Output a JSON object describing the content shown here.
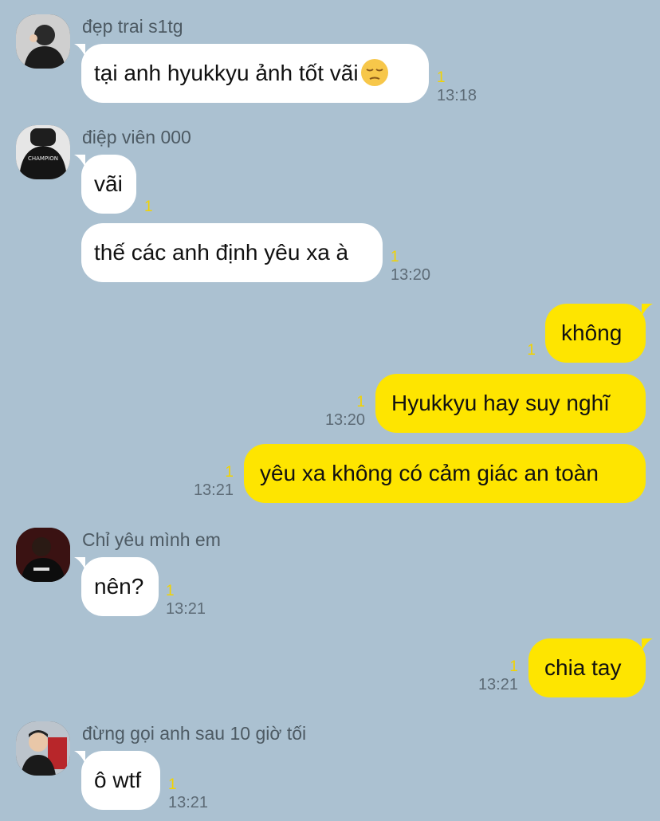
{
  "messages": [
    {
      "sender": "đẹp trai s1tg",
      "text": "tại anh hyukkyu ảnh tốt vãi",
      "emoji": "pensive-face-emoji",
      "unread": "1",
      "time": "13:18"
    },
    {
      "sender": "điệp viên 000",
      "text": "vãi",
      "unread": "1",
      "time": ""
    },
    {
      "text": "thế các anh định yêu xa à",
      "unread": "1",
      "time": "13:20"
    },
    {
      "text": "không",
      "unread": "1",
      "time": ""
    },
    {
      "text": "Hyukkyu hay suy nghĩ",
      "unread": "1",
      "time": "13:20"
    },
    {
      "text": "yêu xa không có cảm giác an toàn",
      "unread": "1",
      "time": "13:21"
    },
    {
      "sender": "Chỉ yêu mình em",
      "text": "nên?",
      "unread": "1",
      "time": "13:21"
    },
    {
      "text": "chia tay",
      "unread": "1",
      "time": "13:21"
    },
    {
      "sender": "đừng gọi anh sau 10 giờ tối",
      "text": "ô wtf",
      "unread": "1",
      "time": "13:21"
    }
  ],
  "colors": {
    "background": "#abc1d1",
    "incoming_bubble": "#ffffff",
    "outgoing_bubble": "#fee500",
    "unread_count": "#f2d300"
  }
}
